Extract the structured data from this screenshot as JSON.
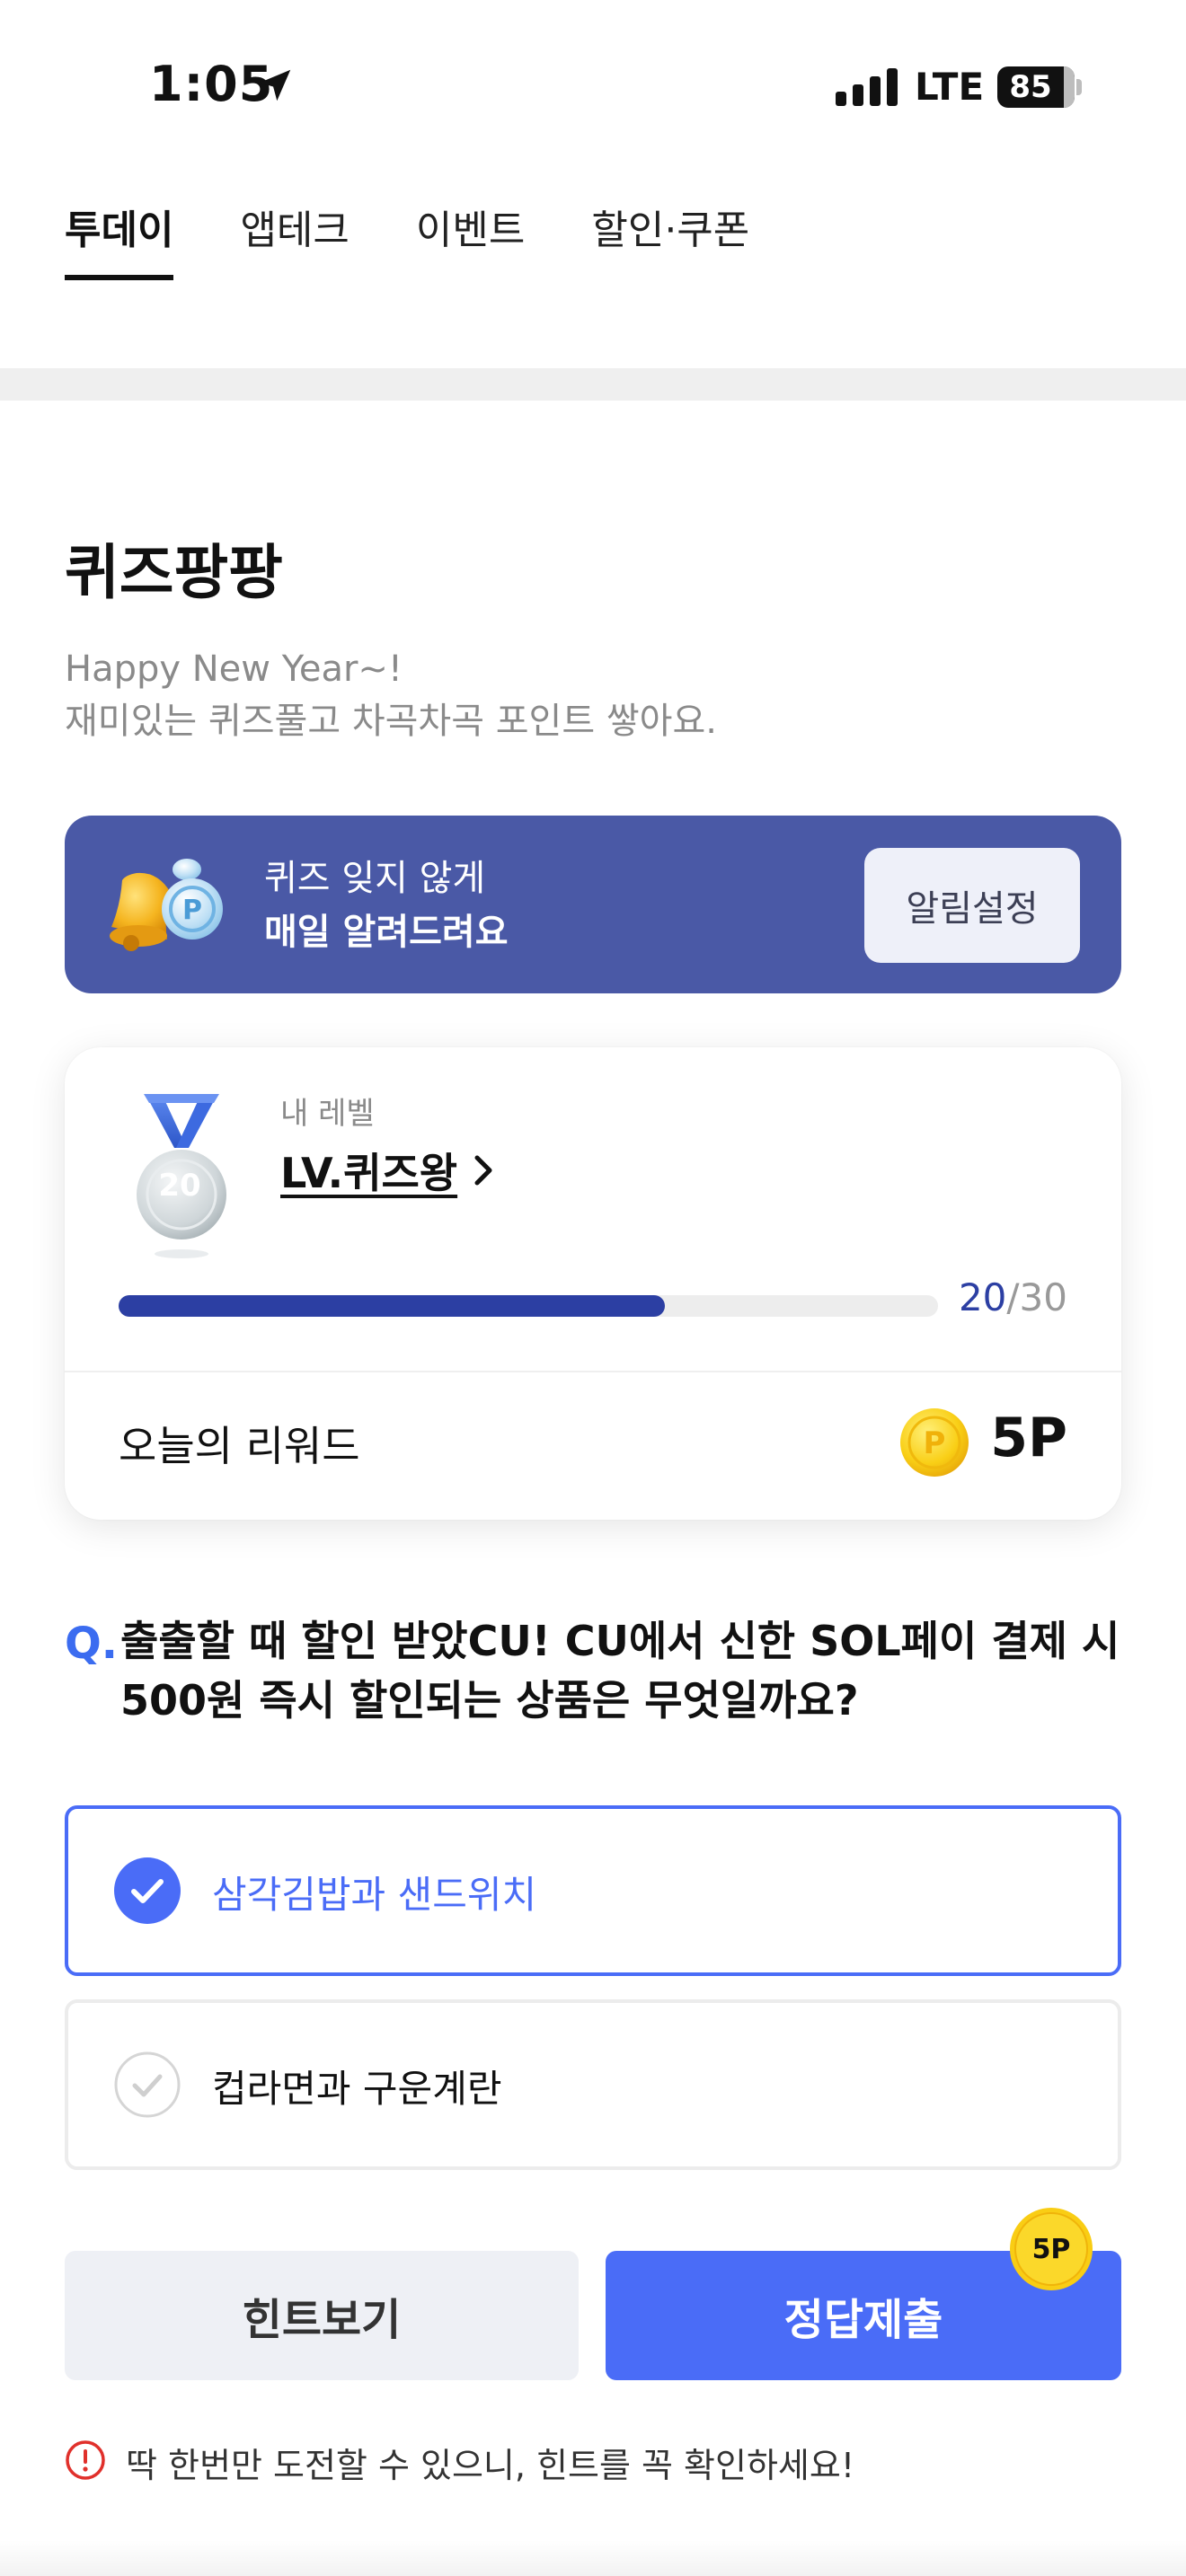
{
  "status_bar": {
    "time": "1:05",
    "network": "LTE",
    "battery": "85",
    "icons": [
      "location-arrow-icon",
      "signal-bars-icon",
      "battery-icon"
    ]
  },
  "tabs": [
    {
      "label": "투데이",
      "active": true
    },
    {
      "label": "앱테크",
      "active": false
    },
    {
      "label": "이벤트",
      "active": false
    },
    {
      "label": "할인·쿠폰",
      "active": false
    }
  ],
  "section": {
    "title": "퀴즈팡팡",
    "subtitle_line1": "Happy New Year~!",
    "subtitle_line2": "재미있는 퀴즈풀고 차곡차곡 포인트 쌓아요."
  },
  "banner": {
    "line1": "퀴즈 잊지 않게",
    "line2": "매일 알려드려요",
    "button_label": "알림설정",
    "icon": "bell-coin-icon",
    "color": "#4a59a6"
  },
  "level_card": {
    "my_level_label": "내 레벨",
    "level_name": "LV.퀴즈왕",
    "medal_number": "20",
    "progress_current": "20",
    "progress_separator": "/",
    "progress_total": "30",
    "progress_fraction": 0.6667,
    "reward_label": "오늘의 리워드",
    "coin_letter": "P",
    "reward_value": "5P"
  },
  "question": {
    "prefix": "Q.",
    "text": "출출할 때 할인 받았CU! CU에서 신한 SOL페이 결제 시 500원 즉시 할인되는 상품은 무엇일까요?"
  },
  "options": [
    {
      "label": "삼각김밥과 샌드위치",
      "selected": true
    },
    {
      "label": "컵라면과 구운계란",
      "selected": false
    }
  ],
  "actions": {
    "hint_label": "힌트보기",
    "submit_label": "정답제출",
    "submit_badge": "5P",
    "accent": "#4a6cf7"
  },
  "warning": {
    "text": "딱 한번만 도전할 수 있으니, 힌트를 꼭 확인하세요!",
    "icon": "exclamation-circle-icon"
  }
}
